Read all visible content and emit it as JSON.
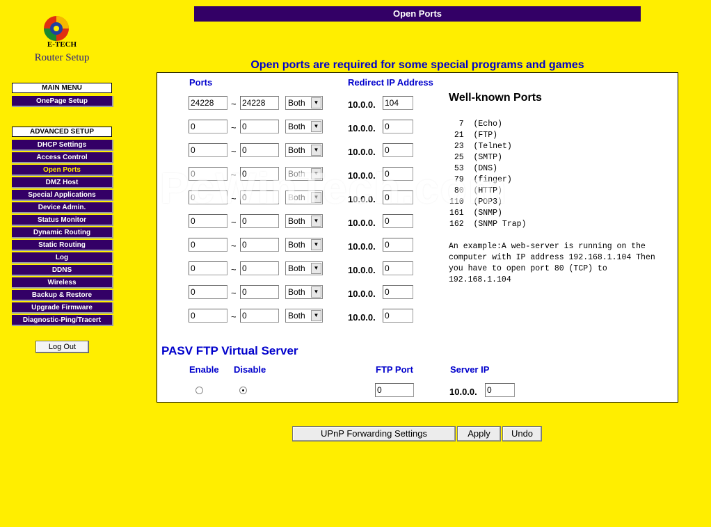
{
  "logo": {
    "brand": "E-TECH",
    "subtitle": "Router Setup"
  },
  "header": {
    "title": "Open Ports",
    "subtitle": "Open ports are required for some special programs and games"
  },
  "sidebar": {
    "main_menu": "MAIN MENU",
    "main_items": [
      {
        "label": "OnePage Setup"
      }
    ],
    "advanced_setup": "ADVANCED SETUP",
    "advanced_items": [
      {
        "label": "DHCP Settings"
      },
      {
        "label": "Access Control"
      },
      {
        "label": "Open Ports",
        "active": true
      },
      {
        "label": "DMZ Host"
      },
      {
        "label": "Special Applications"
      },
      {
        "label": "Device Admin."
      },
      {
        "label": "Status Monitor"
      },
      {
        "label": "Dynamic Routing"
      },
      {
        "label": "Static Routing"
      },
      {
        "label": "Log"
      },
      {
        "label": "DDNS"
      },
      {
        "label": "Wireless"
      },
      {
        "label": "Backup & Restore"
      },
      {
        "label": "Upgrade Firmware"
      },
      {
        "label": "Diagnostic-Ping/Tracert"
      }
    ],
    "logout": "Log Out"
  },
  "ports_table": {
    "ports_header": "Ports",
    "redirect_header": "Redirect IP Address",
    "ip_prefix": "10.0.0.",
    "rows": [
      {
        "start": "24228",
        "end": "24228",
        "protocol": "Both",
        "ip": "104"
      },
      {
        "start": "0",
        "end": "0",
        "protocol": "Both",
        "ip": "0"
      },
      {
        "start": "0",
        "end": "0",
        "protocol": "Both",
        "ip": "0"
      },
      {
        "start": "0",
        "end": "0",
        "protocol": "Both",
        "ip": "0"
      },
      {
        "start": "0",
        "end": "0",
        "protocol": "Both",
        "ip": "0"
      },
      {
        "start": "0",
        "end": "0",
        "protocol": "Both",
        "ip": "0"
      },
      {
        "start": "0",
        "end": "0",
        "protocol": "Both",
        "ip": "0"
      },
      {
        "start": "0",
        "end": "0",
        "protocol": "Both",
        "ip": "0"
      },
      {
        "start": "0",
        "end": "0",
        "protocol": "Both",
        "ip": "0"
      },
      {
        "start": "0",
        "end": "0",
        "protocol": "Both",
        "ip": "0"
      }
    ]
  },
  "well_known": {
    "title": "Well-known Ports",
    "list": "  7  (Echo)\n 21  (FTP)\n 23  (Telnet)\n 25  (SMTP)\n 53  (DNS)\n 79  (finger)\n 80  (HTTP)\n110  (POP3)\n161  (SNMP)\n162  (SNMP Trap)",
    "example": "An example:A web-server is running on the computer with IP address 192.168.1.104 Then you have to open port 80 (TCP) to 192.168.1.104"
  },
  "pasv": {
    "title": "PASV FTP Virtual Server",
    "enable_label": "Enable",
    "disable_label": "Disable",
    "ftp_port_label": "FTP Port",
    "server_ip_label": "Server IP",
    "enabled": false,
    "ftp_port": "0",
    "ip_prefix": "10.0.0.",
    "server_ip": "0"
  },
  "buttons": {
    "upnp": "UPnP Forwarding Settings",
    "apply": "Apply",
    "undo": "Undo"
  },
  "watermark": "PcWinTech.com",
  "colors": {
    "background": "#ffee00",
    "menu": "#330066",
    "heading_blue": "#0000cc"
  }
}
